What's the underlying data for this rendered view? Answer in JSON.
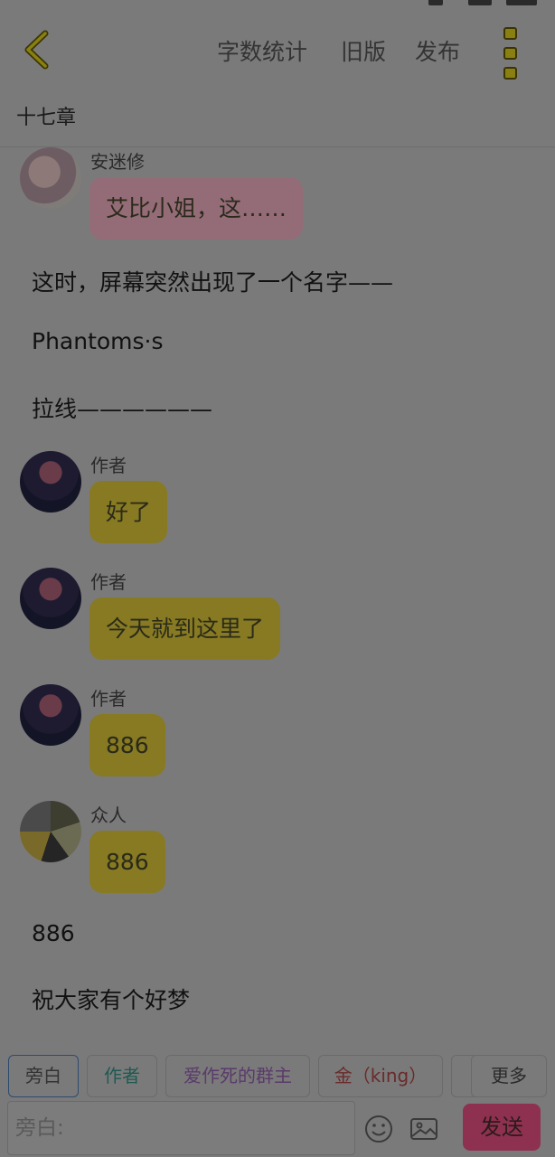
{
  "header": {
    "word_count_label": "字数统计",
    "old_version_label": "旧版",
    "publish_label": "发布"
  },
  "chapter": {
    "title": "十七章"
  },
  "messages": [
    {
      "type": "bubble",
      "sender": "安迷修",
      "text": "艾比小姐，这……",
      "color": "#946c78"
    },
    {
      "type": "narration",
      "text": "这时，屏幕突然出现了一个名字——"
    },
    {
      "type": "narration",
      "text": "Phantoms·s"
    },
    {
      "type": "narration",
      "text": "拉线——————"
    },
    {
      "type": "bubble",
      "sender": "作者",
      "text": "好了",
      "color": "#877a22"
    },
    {
      "type": "bubble",
      "sender": "作者",
      "text": "今天就到这里了",
      "color": "#877a22"
    },
    {
      "type": "bubble",
      "sender": "作者",
      "text": "886",
      "color": "#877a22"
    },
    {
      "type": "bubble",
      "sender": "众人",
      "text": "886",
      "color": "#877a22"
    },
    {
      "type": "narration",
      "text": "886"
    },
    {
      "type": "narration",
      "text": "祝大家有个好梦"
    }
  ],
  "character_tabs": [
    {
      "label": "旁白",
      "color": "#3d3d3d"
    },
    {
      "label": "作者",
      "color": "#1f5a52"
    },
    {
      "label": "爱作死的群主",
      "color": "#5a3a6a"
    },
    {
      "label": "金（king）",
      "color": "#6a2a2a"
    }
  ],
  "more_label": "更多",
  "input": {
    "placeholder": "旁白:"
  },
  "send_label": "发送",
  "colors": {
    "accent_gold": "#877a22",
    "send": "#8e3150",
    "pink_bubble": "#946c78"
  }
}
